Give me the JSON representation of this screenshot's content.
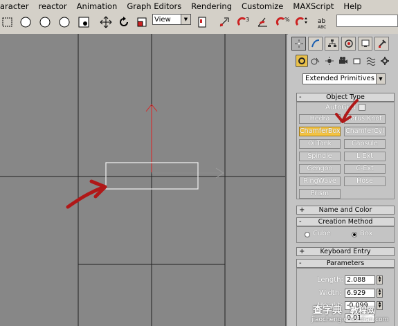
{
  "menu": [
    "aracter",
    "reactor",
    "Animation",
    "Graph Editors",
    "Rendering",
    "Customize",
    "MAXScript",
    "Help"
  ],
  "toolbar": {
    "view_label": "View"
  },
  "panel": {
    "tabs": [
      "create-tab",
      "modify-tab",
      "hierarchy-tab",
      "motion-tab",
      "display-tab",
      "utilities-tab"
    ],
    "category_dropdown": "Extended Primitives",
    "object_type": {
      "title": "Object Type",
      "autogrid": "AutoGrid",
      "buttons": [
        "Hedra",
        "Torus Knot",
        "ChamferBox",
        "ChamferCyl",
        "OilTank",
        "Capsule",
        "Spindle",
        "L-Ext",
        "Gengon",
        "C-Ext",
        "RingWave",
        "Hose",
        "Prism"
      ],
      "active": "ChamferBox"
    },
    "name_color": "Name and Color",
    "creation_method": {
      "title": "Creation Method",
      "opt_cube": "Cube",
      "opt_box": "Box",
      "selected": "Box"
    },
    "keyboard_entry": "Keyboard Entry",
    "parameters": {
      "title": "Parameters",
      "length_label": "Length:",
      "length": "2.088",
      "width_label": "Width:",
      "width": "6.929",
      "height_label": "Height:",
      "height": "-0.099",
      "fillet_value": "0.01"
    }
  },
  "watermark": {
    "line1": "查字典",
    "line2": "教程网",
    "line3": "jiaocheng.chazidian.com"
  },
  "colors": {
    "accent_active": "#f5c442",
    "annotation_arrow": "#b01818",
    "viewport_bg": "#878787"
  }
}
